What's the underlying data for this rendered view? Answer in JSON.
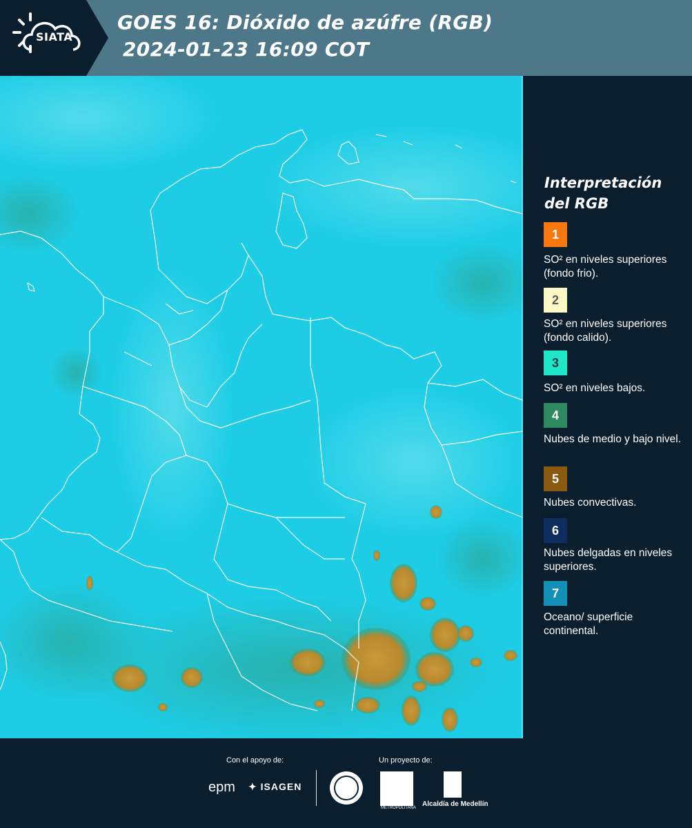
{
  "header": {
    "logo_text": "SIATA",
    "title_line1": "GOES 16: Dióxido de azúfre (RGB)",
    "title_line2": "2024-01-23 16:09 COT"
  },
  "legend": {
    "title_line1": "Interpretación",
    "title_line2": "del RGB",
    "items": [
      {
        "number": "1",
        "color": "#f7780e",
        "text_color": "#ffffff",
        "label": "SO² en niveles superiores (fondo frio)."
      },
      {
        "number": "2",
        "color": "#fdf7c6",
        "text_color": "#5a5a5a",
        "label": "SO² en niveles superiores (fondo calido)."
      },
      {
        "number": "3",
        "color": "#1fe6c8",
        "text_color": "#0b3a3a",
        "label": "SO² en niveles bajos."
      },
      {
        "number": "4",
        "color": "#2e8a5e",
        "text_color": "#ffffff",
        "label": "Nubes de medio y bajo nivel."
      },
      {
        "number": "5",
        "color": "#8a5a10",
        "text_color": "#ffffff",
        "label": "Nubes convectivas."
      },
      {
        "number": "6",
        "color": "#0d2d5e",
        "text_color": "#ffffff",
        "label": "Nubes delgadas en niveles superiores."
      },
      {
        "number": "7",
        "color": "#1490b8",
        "text_color": "#ffffff",
        "label": "Oceano/ superficie continental."
      }
    ]
  },
  "footer": {
    "support_label": "Con el apoyo de:",
    "project_label": "Un proyecto de:",
    "sponsor1": "epm",
    "sponsor2": "ISAGEN",
    "partner1_small": "METROPOLITANA",
    "partner2": "Alcaldía de Medellín"
  },
  "map": {
    "background_color": "#1ecfe6",
    "convective_color": "#b08a30",
    "border_color": "#ffffff"
  }
}
